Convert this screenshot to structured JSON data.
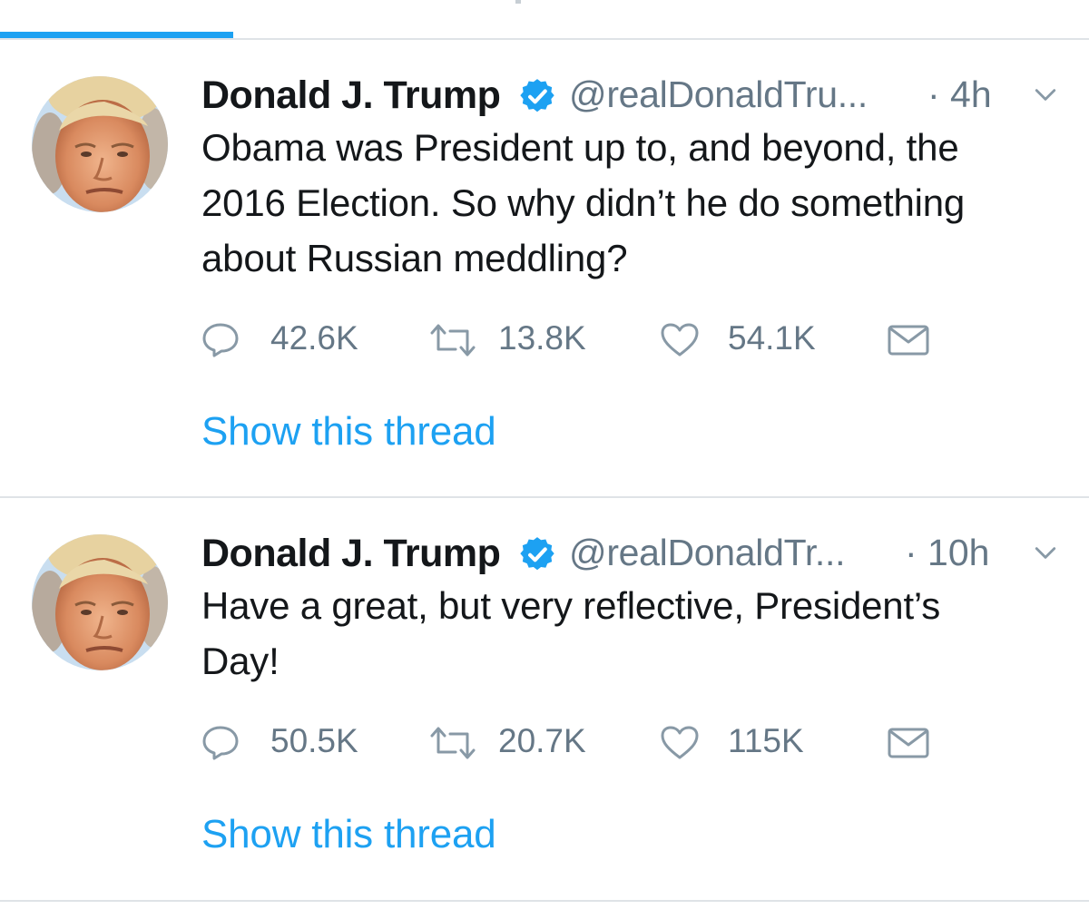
{
  "colors": {
    "accent": "#1da1f2",
    "text_primary": "#14171a",
    "text_secondary": "#657786",
    "divider": "#dfe3e7"
  },
  "tweets": [
    {
      "display_name": "Donald J. Trump",
      "handle": "@realDonaldTru...",
      "time": "· 4h",
      "text_lines": [
        "Obama was President up to, and beyond, the",
        "2016 Election. So why didn’t he do something",
        "about Russian meddling?"
      ],
      "replies": "42.6K",
      "retweets": "13.8K",
      "likes": "54.1K",
      "thread_link": "Show this thread",
      "icons": [
        "verified-badge-icon",
        "caret-down-icon",
        "reply-icon",
        "retweet-icon",
        "like-icon",
        "mail-icon"
      ]
    },
    {
      "display_name": "Donald J. Trump",
      "handle": "@realDonaldTr...",
      "time": "· 10h",
      "text_lines": [
        "Have a great, but very reflective, President’s",
        "Day!"
      ],
      "replies": "50.5K",
      "retweets": "20.7K",
      "likes": "115K",
      "thread_link": "Show this thread",
      "icons": [
        "verified-badge-icon",
        "caret-down-icon",
        "reply-icon",
        "retweet-icon",
        "like-icon",
        "mail-icon"
      ]
    }
  ]
}
